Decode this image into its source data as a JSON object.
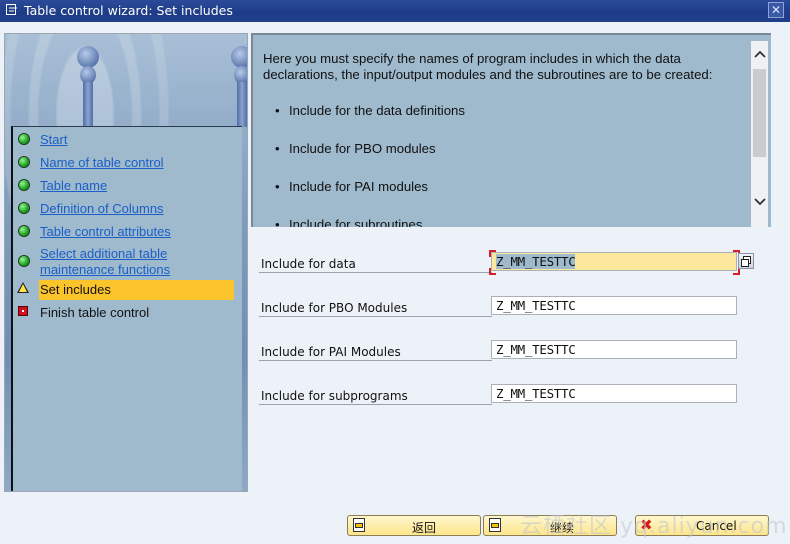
{
  "window": {
    "title": "Table control wizard: Set includes",
    "close_label": "✕"
  },
  "steps": [
    {
      "label": "Start",
      "status": "done"
    },
    {
      "label": "Name of table control",
      "status": "done"
    },
    {
      "label": "Table name",
      "status": "done"
    },
    {
      "label": "Definition of Columns",
      "status": "done"
    },
    {
      "label": "Table control attributes",
      "status": "done"
    },
    {
      "label": "Select additional table maintenance functions",
      "status": "done"
    },
    {
      "label": "Set includes",
      "status": "current"
    },
    {
      "label": "Finish table control",
      "status": "pending"
    }
  ],
  "info": {
    "intro": "Here you must specify the names of program includes in which the data declarations, the input/output modules and the subroutines are to be created:",
    "bullets": [
      "Include for the data definitions",
      "Include for PBO modules",
      "Include for PAI modules",
      "Include for subroutines"
    ],
    "scroll_up": "⌃",
    "scroll_down": "⌄"
  },
  "fields": [
    {
      "label": "Include for data",
      "value": "Z_MM_TESTTC",
      "focused": true
    },
    {
      "label": "Include for PBO Modules",
      "value": "Z_MM_TESTTC"
    },
    {
      "label": "Include for PAI Modules",
      "value": "Z_MM_TESTTC"
    },
    {
      "label": "Include for subprograms",
      "value": "Z_MM_TESTTC"
    }
  ],
  "buttons": {
    "back": "返回",
    "continue": "继续",
    "cancel": "Cancel"
  },
  "watermark": "云栖社区 yq.aliyun.com"
}
